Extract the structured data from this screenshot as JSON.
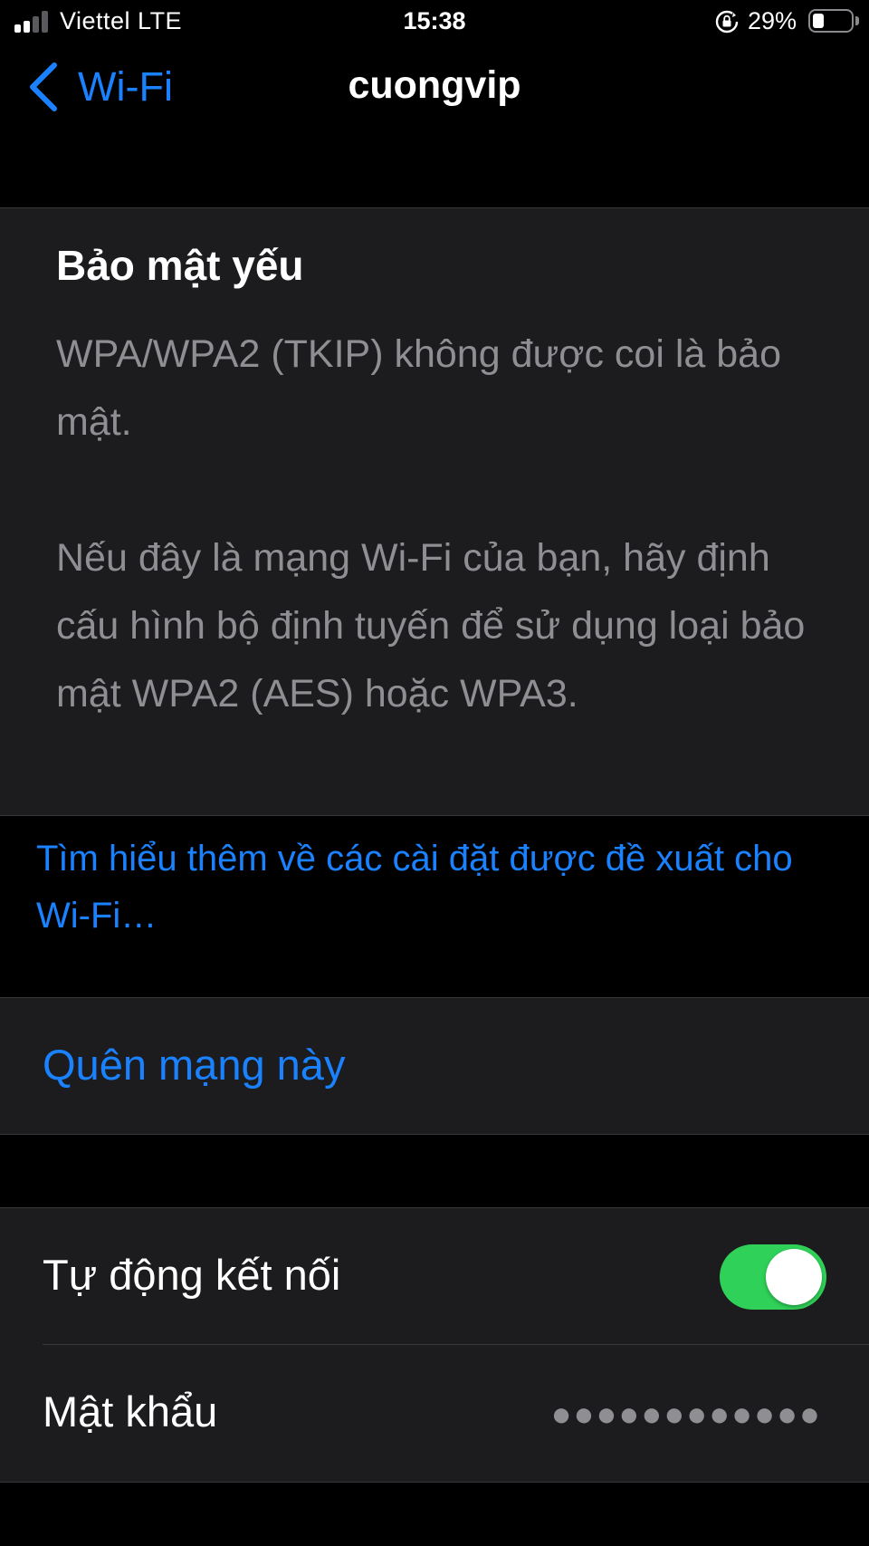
{
  "status_bar": {
    "carrier": "Viettel  LTE",
    "time": "15:38",
    "battery_percent": "29%",
    "battery_level": 0.29,
    "signal_bars_filled": 2,
    "signal_bars_total": 4
  },
  "nav": {
    "back_label": "Wi-Fi",
    "title": "cuongvip"
  },
  "warning": {
    "title": "Bảo mật yếu",
    "paragraph_1": "WPA/WPA2 (TKIP) không được coi là bảo mật.",
    "paragraph_2": "Nếu đây là mạng Wi-Fi của bạn, hãy định cấu hình bộ định tuyến để sử dụng loại bảo mật WPA2 (AES) hoặc WPA3."
  },
  "learn_more_link": "Tìm hiểu thêm về các cài đặt được đề xuất cho Wi-Fi…",
  "forget_network_label": "Quên mạng này",
  "settings": {
    "auto_join_label": "Tự động kết nối",
    "auto_join_on": true,
    "password_label": "Mật khẩu",
    "password_masked": "●●●●●●●●●●●●"
  },
  "colors": {
    "accent": "#1a82ff",
    "toggle_on": "#30d158",
    "background": "#000000",
    "cell": "#1c1c1e",
    "secondary_text": "#8e8e93",
    "signal_dim": "#5a5a5e"
  },
  "icons": {
    "back": "chevron-left-icon",
    "rotation_lock": "rotation-lock-icon",
    "battery": "battery-icon",
    "signal": "cellular-signal-icon"
  }
}
